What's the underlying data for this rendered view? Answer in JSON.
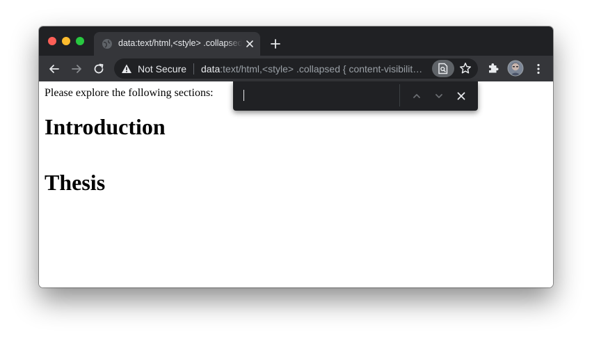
{
  "tab": {
    "title": "data:text/html,<style> .collapsed { content-visibility: hidden-matchable; } </style>"
  },
  "omnibox": {
    "security_label": "Not Secure",
    "url_scheme": "data",
    "url_rest": ":text/html,<style> .collapsed { content-visibility: hidden-matchable; } </style>"
  },
  "find_bar": {
    "query": "",
    "placeholder": ""
  },
  "page": {
    "intro": "Please explore the following sections:",
    "headings": [
      "Introduction",
      "Thesis"
    ]
  },
  "colors": {
    "tabstrip_bg": "#202124",
    "toolbar_bg": "#35363a",
    "traffic_red": "#fe5f57",
    "traffic_yellow": "#febc2e",
    "traffic_green": "#28c840"
  },
  "icons": {
    "tab": [
      "globe-icon",
      "close-icon",
      "plus-icon"
    ],
    "toolbar": [
      "back-arrow-icon",
      "forward-arrow-icon",
      "reload-icon",
      "warning-icon",
      "find-in-page-icon",
      "star-icon",
      "puzzle-icon",
      "avatar",
      "kebab-menu-icon"
    ],
    "find_bar": [
      "chevron-up-icon",
      "chevron-down-icon",
      "close-icon"
    ]
  }
}
